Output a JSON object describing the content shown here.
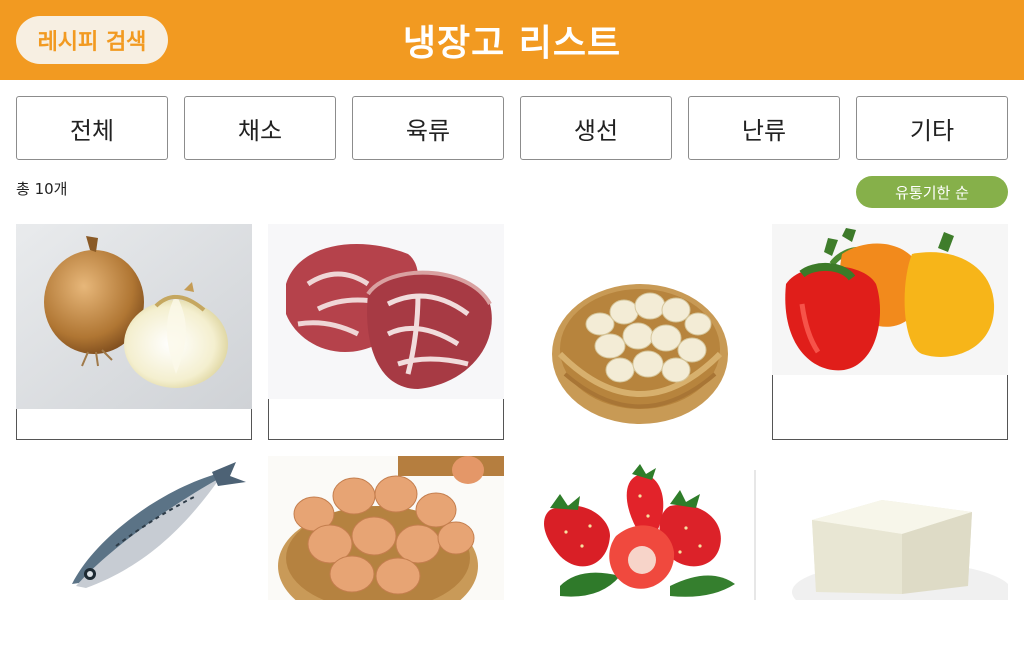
{
  "header": {
    "title": "냉장고 리스트",
    "recipe_search_label": "레시피 검색",
    "background": "#f29a21"
  },
  "tabs": [
    "전체",
    "채소",
    "육류",
    "생선",
    "난류",
    "기타"
  ],
  "list": {
    "count_text": "총 10개",
    "sort_label": "유통기한 순",
    "sort_color": "#86b04a"
  },
  "items": [
    {
      "name": "",
      "icon": "onion-image"
    },
    {
      "name": "",
      "icon": "meat-image"
    },
    {
      "name": "",
      "icon": "garlic-image"
    },
    {
      "name": "",
      "icon": "paprika-image"
    },
    {
      "name": "",
      "icon": "mackerel-image"
    },
    {
      "name": "",
      "icon": "eggs-image"
    },
    {
      "name": "",
      "icon": "strawberry-image"
    },
    {
      "name": "",
      "icon": "tofu-image"
    }
  ]
}
